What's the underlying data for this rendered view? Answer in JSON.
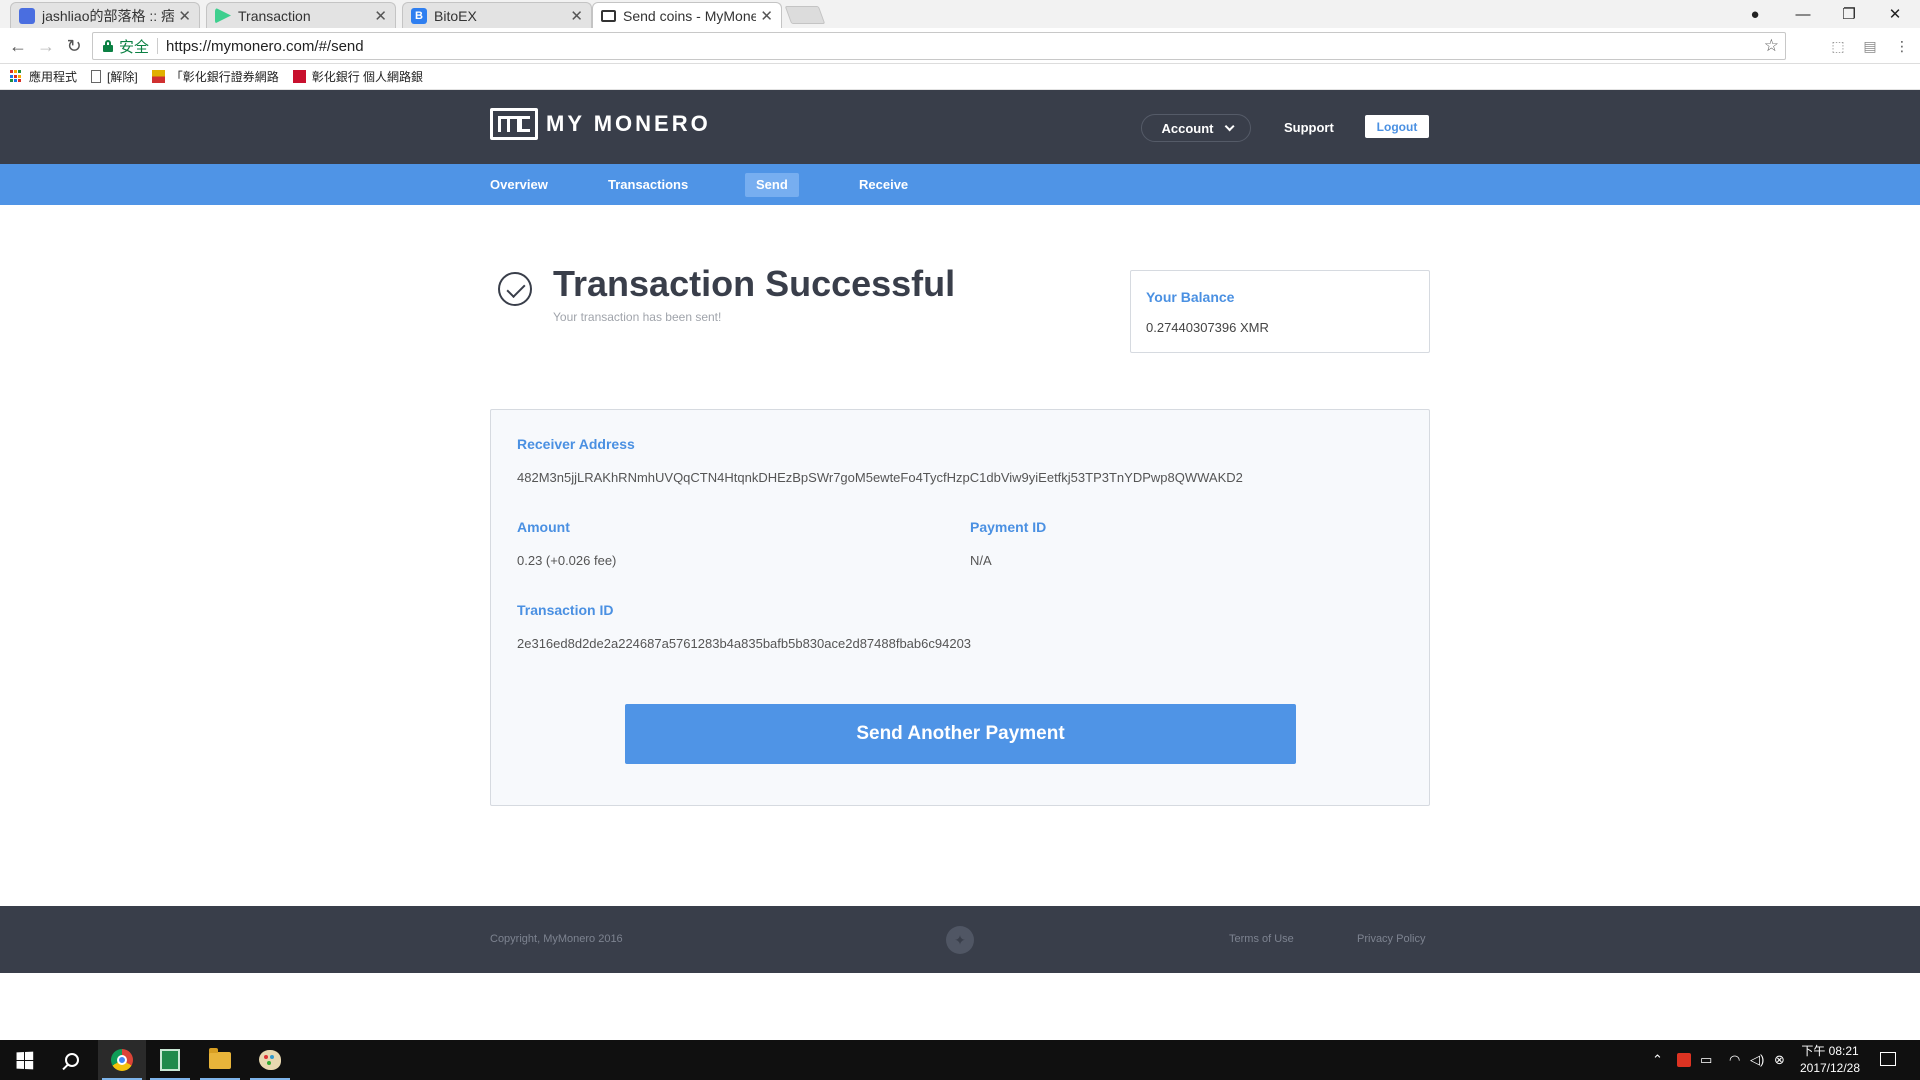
{
  "browser": {
    "tabs": [
      {
        "title": "jashliao的部落格 :: 痞客邦",
        "favicon_color": "#4a6ee0"
      },
      {
        "title": "Transaction",
        "favicon_color": "#3ecf8e"
      },
      {
        "title": "BitoEX",
        "favicon_color": "#2f7ff0"
      },
      {
        "title": "Send coins - MyMonero",
        "favicon_color": "#333333"
      }
    ],
    "secure_label": "安全",
    "url": "https://mymonero.com/#/send",
    "bookmarks": [
      {
        "label": "應用程式",
        "icon": "apps-grid-icon"
      },
      {
        "label": "[解除]",
        "icon": "page-icon"
      },
      {
        "label": "「彰化銀行證券網路",
        "icon": "bank-flag-icon"
      },
      {
        "label": "彰化銀行 個人網路銀",
        "icon": "bank-red-icon"
      }
    ]
  },
  "header": {
    "logo_text": "MY MONERO",
    "account_label": "Account",
    "support_label": "Support",
    "logout_label": "Logout"
  },
  "nav": {
    "overview": "Overview",
    "transactions": "Transactions",
    "send": "Send",
    "receive": "Receive"
  },
  "status": {
    "title": "Transaction Successful",
    "subtitle": "Your transaction has been sent!"
  },
  "balance": {
    "label": "Your Balance",
    "value": "0.27440307396 XMR"
  },
  "details": {
    "receiver_label": "Receiver Address",
    "receiver_value": "482M3n5jjLRAKhRNmhUVQqCTN4HtqnkDHEzBpSWr7goM5ewteFo4TycfHzpC1dbViw9yiEetfkj53TP3TnYDPwp8QWWAKD2",
    "amount_label": "Amount",
    "amount_value": "0.23 (+0.026 fee)",
    "payment_id_label": "Payment ID",
    "payment_id_value": "N/A",
    "tx_id_label": "Transaction ID",
    "tx_id_value": "2e316ed8d2de2a224687a5761283b4a835bafb5b830ace2d87488fbab6c94203",
    "send_another_label": "Send Another Payment"
  },
  "footer": {
    "copyright": "Copyright, MyMonero 2016",
    "terms": "Terms of Use",
    "privacy": "Privacy Policy"
  },
  "taskbar": {
    "time": "下午 08:21",
    "date": "2017/12/28"
  },
  "colors": {
    "header_bg": "#393e4a",
    "nav_bg": "#4f94e6",
    "accent": "#4a90e2"
  }
}
